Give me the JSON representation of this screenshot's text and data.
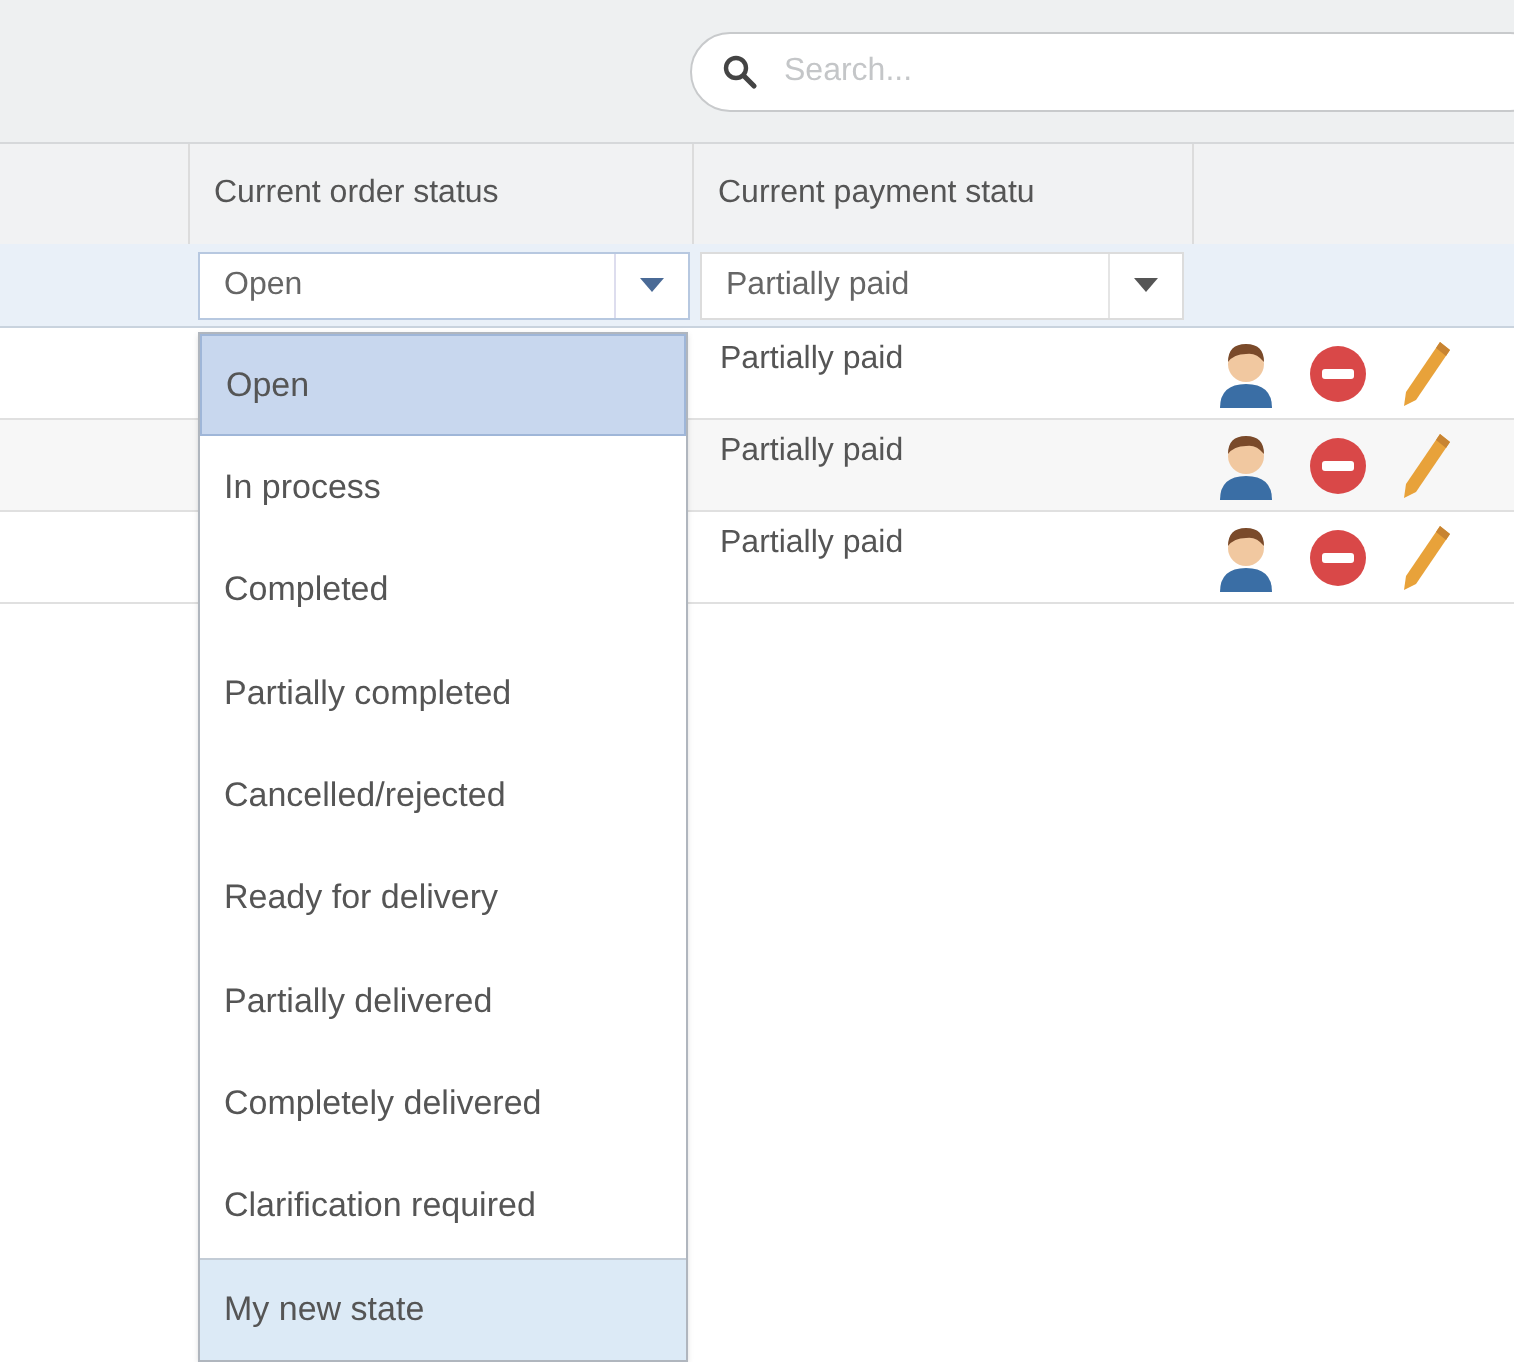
{
  "search": {
    "placeholder": "Search..."
  },
  "columns": [
    "Current order status",
    "Current payment statu"
  ],
  "filters": {
    "order_status": "Open",
    "payment_status": "Partially paid"
  },
  "rows": [
    {
      "payment": "Partially paid"
    },
    {
      "payment": "Partially paid"
    },
    {
      "payment": "Partially paid"
    }
  ],
  "dropdown": [
    {
      "label": "Open",
      "selected": true,
      "hovered": false
    },
    {
      "label": "In process",
      "selected": false,
      "hovered": false
    },
    {
      "label": "Completed",
      "selected": false,
      "hovered": false
    },
    {
      "label": "Partially completed",
      "selected": false,
      "hovered": false
    },
    {
      "label": "Cancelled/rejected",
      "selected": false,
      "hovered": false
    },
    {
      "label": "Ready for delivery",
      "selected": false,
      "hovered": false
    },
    {
      "label": "Partially delivered",
      "selected": false,
      "hovered": false
    },
    {
      "label": "Completely delivered",
      "selected": false,
      "hovered": false
    },
    {
      "label": "Clarification required",
      "selected": false,
      "hovered": false
    },
    {
      "label": "My new state",
      "selected": false,
      "hovered": true
    }
  ]
}
